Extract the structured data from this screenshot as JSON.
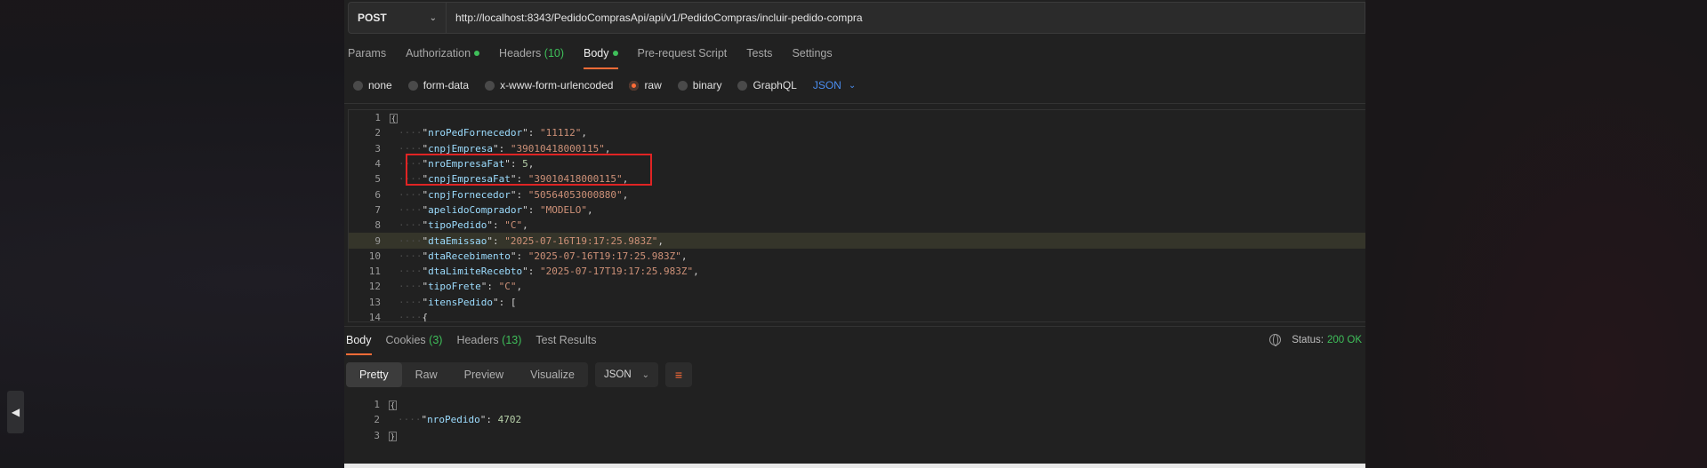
{
  "request": {
    "method": "POST",
    "url": "http://localhost:8343/PedidoComprasApi/api/v1/PedidoCompras/incluir-pedido-compra"
  },
  "request_tabs": {
    "params": "Params",
    "authorization": "Authorization",
    "headers": "Headers",
    "headers_count": "(10)",
    "body": "Body",
    "pre_request": "Pre-request Script",
    "tests": "Tests",
    "settings": "Settings"
  },
  "body_types": {
    "none": "none",
    "form_data": "form-data",
    "urlencoded": "x-www-form-urlencoded",
    "raw": "raw",
    "binary": "binary",
    "graphql": "GraphQL",
    "format": "JSON"
  },
  "request_body": {
    "line_numbers": [
      "1",
      "2",
      "3",
      "4",
      "5",
      "6",
      "7",
      "8",
      "9",
      "10",
      "11",
      "12",
      "13",
      "14"
    ],
    "fields": [
      {
        "key": "nroPedFornecedor",
        "value": "\"11112\"",
        "type": "string"
      },
      {
        "key": "cnpjEmpresa",
        "value": "\"39010418000115\"",
        "type": "string"
      },
      {
        "key": "nroEmpresaFat",
        "value": "5",
        "type": "number"
      },
      {
        "key": "cnpjEmpresaFat",
        "value": "\"39010418000115\"",
        "type": "string"
      },
      {
        "key": "cnpjFornecedor",
        "value": "\"50564053000880\"",
        "type": "string"
      },
      {
        "key": "apelidoComprador",
        "value": "\"MODELO\"",
        "type": "string"
      },
      {
        "key": "tipoPedido",
        "value": "\"C\"",
        "type": "string"
      },
      {
        "key": "dtaEmissao",
        "value": "\"2025-07-16T19:17:25.983Z\"",
        "type": "string"
      },
      {
        "key": "dtaRecebimento",
        "value": "\"2025-07-16T19:17:25.983Z\"",
        "type": "string"
      },
      {
        "key": "dtaLimiteRecebto",
        "value": "\"2025-07-17T19:17:25.983Z\"",
        "type": "string"
      },
      {
        "key": "tipoFrete",
        "value": "\"C\"",
        "type": "string"
      },
      {
        "key": "itensPedido",
        "value": "[",
        "type": "array"
      }
    ],
    "line14": "{"
  },
  "response_tabs": {
    "body": "Body",
    "cookies": "Cookies",
    "cookies_count": "(3)",
    "headers": "Headers",
    "headers_count": "(13)",
    "test_results": "Test Results"
  },
  "status": {
    "label": "Status:",
    "value": "200 OK"
  },
  "response_view": {
    "pretty": "Pretty",
    "raw": "Raw",
    "preview": "Preview",
    "visualize": "Visualize",
    "format": "JSON"
  },
  "response_body": {
    "line_numbers": [
      "1",
      "2",
      "3"
    ],
    "key": "nroPedido",
    "value": "4702"
  },
  "colors": {
    "accent": "#ff6c37",
    "success": "#3fbf5a",
    "link": "#4a8df0",
    "highlight_box": "#e02424"
  }
}
